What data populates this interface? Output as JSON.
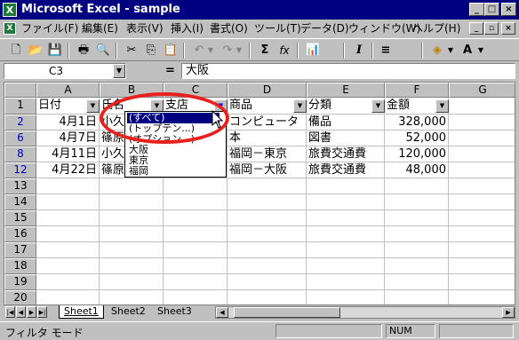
{
  "window": {
    "title": "Microsoft Excel - sample",
    "controls": [
      "_",
      "□",
      "×"
    ]
  },
  "menu": {
    "items": [
      "ファイル(F)",
      "編集(E)",
      "表示(V)",
      "挿入(I)",
      "書式(O)",
      "ツール(T)",
      "データ(D)",
      "ウィンドウ(W)",
      "ヘルプ(H)"
    ],
    "doc_controls": [
      "_",
      "▫",
      "×"
    ]
  },
  "toolbar": {
    "buttons": [
      {
        "icon": "new-file-icon",
        "glyph": "🗋"
      },
      {
        "icon": "open-folder-icon",
        "glyph": "📂"
      },
      {
        "icon": "save-icon",
        "glyph": "💾"
      },
      {
        "icon": "print-icon",
        "glyph": "🖶"
      },
      {
        "icon": "print-preview-icon",
        "glyph": "🔍"
      },
      {
        "icon": "cut-icon",
        "glyph": "✂"
      },
      {
        "icon": "copy-icon",
        "glyph": "⎘"
      },
      {
        "icon": "paste-icon",
        "glyph": "📋"
      },
      {
        "icon": "undo-icon",
        "glyph": "↶"
      },
      {
        "icon": "redo-icon",
        "glyph": "↷"
      },
      {
        "icon": "autosum-icon",
        "glyph": "Σ"
      },
      {
        "icon": "function-icon",
        "glyph": "fx"
      },
      {
        "icon": "chart-wizard-icon",
        "glyph": "📊"
      },
      {
        "icon": "italic-icon",
        "glyph": "I"
      },
      {
        "icon": "align-center-icon",
        "glyph": "≡"
      },
      {
        "icon": "fill-color-icon",
        "glyph": "◈"
      },
      {
        "icon": "font-color-icon",
        "glyph": "A"
      }
    ]
  },
  "formula_bar": {
    "name_box": "C3",
    "equals": "=",
    "formula": "大阪"
  },
  "columns": [
    "A",
    "B",
    "C",
    "D",
    "E",
    "F",
    "G"
  ],
  "rows": [
    "1",
    "2",
    "6",
    "8",
    "12",
    "13",
    "14",
    "15",
    "16",
    "17",
    "18",
    "19",
    "20"
  ],
  "header_row": [
    "日付",
    "氏名",
    "支店",
    "商品",
    "分類",
    "金額"
  ],
  "data_rows": [
    [
      "4月1日",
      "小久",
      "",
      "コンピュータ",
      "備品",
      "328,000"
    ],
    [
      "4月7日",
      "篠原",
      "",
      "本",
      "図書",
      "52,000"
    ],
    [
      "4月11日",
      "小久",
      "",
      "福岡－東京",
      "旅費交通費",
      "120,000"
    ],
    [
      "4月22日",
      "篠原",
      "",
      "福岡－大阪",
      "旅費交通費",
      "48,000"
    ]
  ],
  "filter_dropdown": {
    "options": [
      "(すべて)",
      "(トップテン...)",
      "(オプション...)",
      "大阪",
      "東京",
      "福岡"
    ],
    "selected_index": 0
  },
  "sheet_tabs": [
    "Sheet1",
    "Sheet2",
    "Sheet3"
  ],
  "active_sheet": 0,
  "status": {
    "mode": "フィルタ モード",
    "num": "NUM"
  },
  "colors": {
    "title_bar": "#000080",
    "highlight_oval": "#e8211c",
    "filtered_rows": "#0000c0"
  }
}
